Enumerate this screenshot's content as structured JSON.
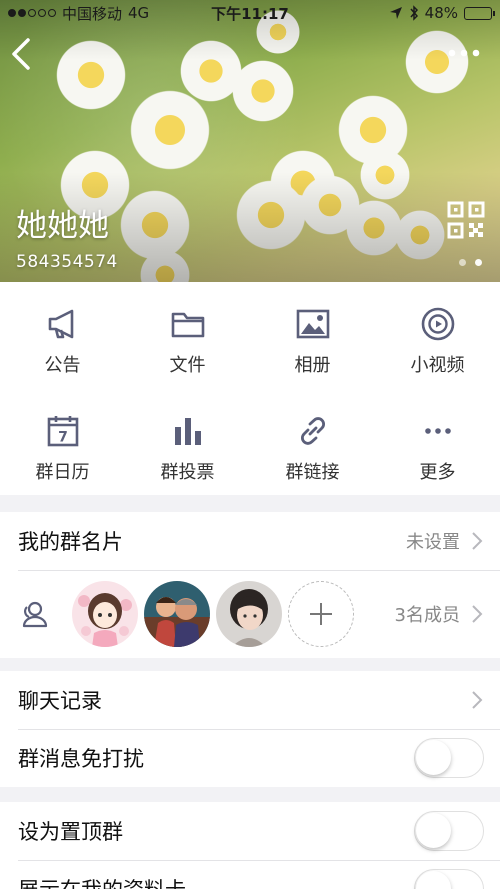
{
  "status_bar": {
    "carrier": "中国移动",
    "network": "4G",
    "time": "下午11:17",
    "battery": "48%",
    "battery_level": 0.48
  },
  "header": {
    "group_name": "她她她",
    "group_id": "584354574",
    "page_count": 2,
    "active_page": 1
  },
  "grid": {
    "items": [
      {
        "label": "公告",
        "icon": "megaphone-icon"
      },
      {
        "label": "文件",
        "icon": "folder-icon"
      },
      {
        "label": "相册",
        "icon": "photo-album-icon"
      },
      {
        "label": "小视频",
        "icon": "video-icon"
      },
      {
        "label": "群日历",
        "icon": "calendar-icon"
      },
      {
        "label": "群投票",
        "icon": "bar-chart-icon"
      },
      {
        "label": "群链接",
        "icon": "link-icon"
      },
      {
        "label": "更多",
        "icon": "more-icon"
      }
    ],
    "calendar_day": "7"
  },
  "card": {
    "title": "我的群名片",
    "value": "未设置"
  },
  "members": {
    "count_label": "3名成员"
  },
  "list1": {
    "chat_history": "聊天记录",
    "do_not_disturb": "群消息免打扰",
    "do_not_disturb_on": false
  },
  "list2": {
    "pin_group": "设为置顶群",
    "pin_group_on": false,
    "show_on_profile": "展示在我的资料卡",
    "show_on_profile_on": false
  },
  "colors": {
    "icon": "#5b5f7a",
    "page_bg": "#f2f2f5",
    "divider": "#e3e3e6"
  }
}
